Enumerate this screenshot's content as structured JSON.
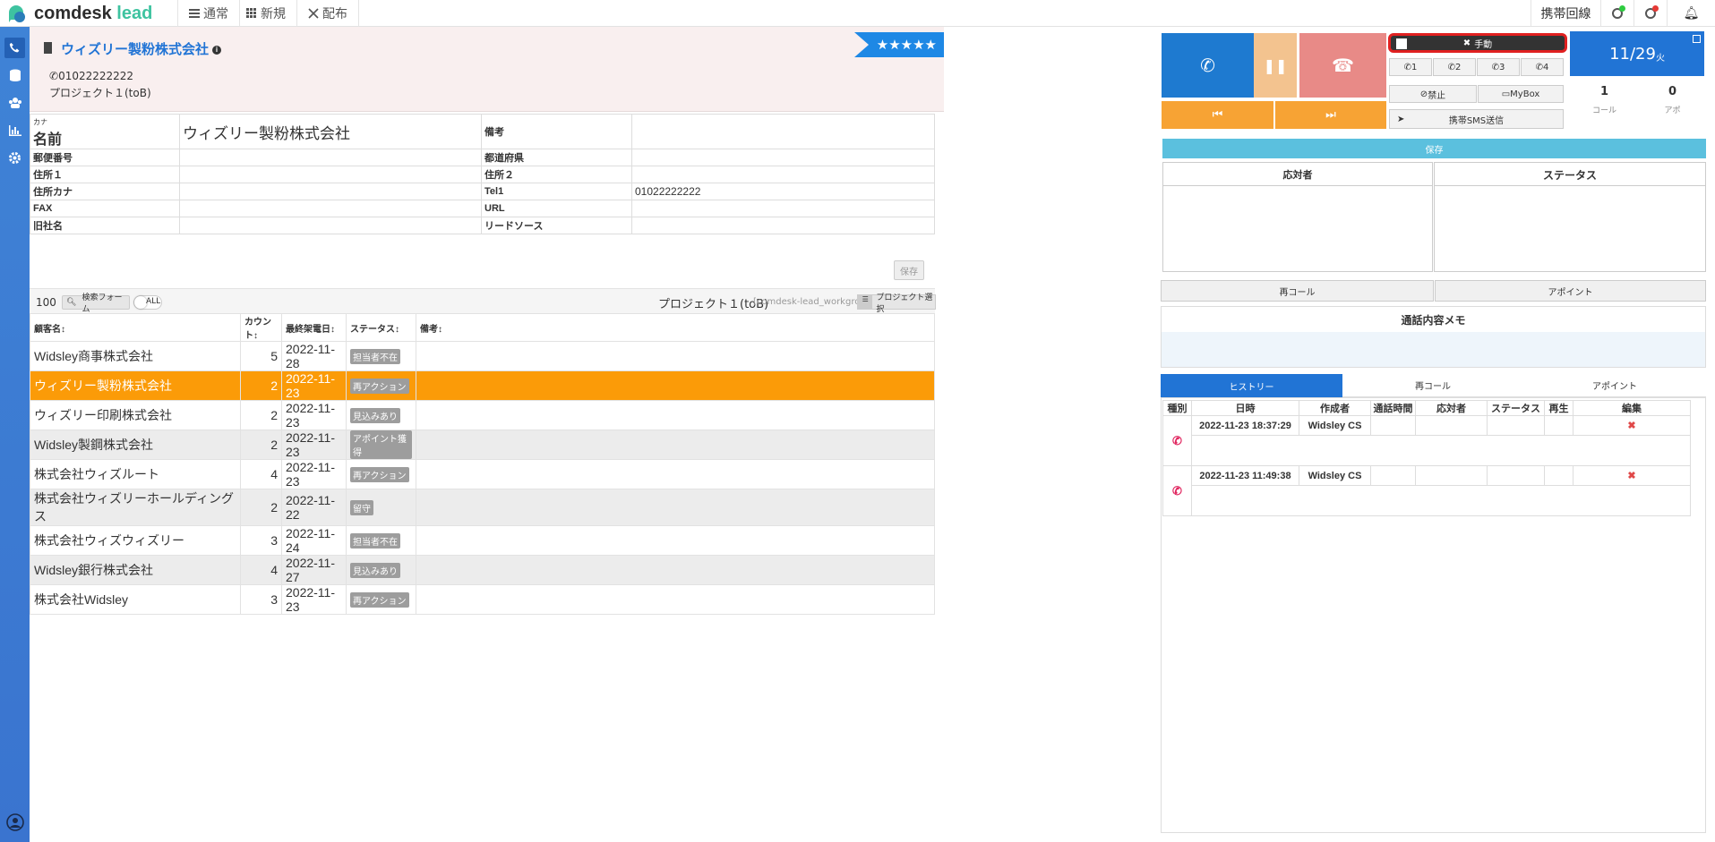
{
  "app": {
    "logo_main": "comdesk",
    "logo_accent": "lead"
  },
  "nav": {
    "normal": "通常",
    "new": "新規",
    "distribute": "配布"
  },
  "topbar_right": {
    "mobile_line": "携帯回線"
  },
  "company": {
    "name": "ウィズリー製粉株式会社",
    "phone": "01022222222",
    "project": "プロジェクト１(toB)",
    "rating": "★★★★★"
  },
  "detail": {
    "kana_label": "カナ",
    "name_label": "名前",
    "name_value": "ウィズリー製粉株式会社",
    "note_label": "備考",
    "zip_label": "郵便番号",
    "pref_label": "都道府県",
    "addr1_label": "住所１",
    "addr2_label": "住所２",
    "addr_kana_label": "住所カナ",
    "tel1_label": "Tel1",
    "tel1_value": "01022222222",
    "fax_label": "FAX",
    "url_label": "URL",
    "old_name_label": "旧社名",
    "lead_source_label": "リードソース",
    "save": "保存"
  },
  "list_toolbar": {
    "count": "100",
    "search_form": "検索フォーム",
    "all": "ALL",
    "project_title": "プロジェクト１(toB)",
    "workgroup": "[comdesk-lead_workgroup]",
    "project_select": "プロジェクト選択"
  },
  "list": {
    "headers": [
      "顧客名",
      "カウント",
      "最終架電日",
      "ステータス",
      "備考"
    ],
    "rows": [
      {
        "name": "Widsley商事株式会社",
        "count": "5",
        "date": "2022-11-28",
        "status": "担当者不在"
      },
      {
        "name": "ウィズリー製粉株式会社",
        "count": "2",
        "date": "2022-11-23",
        "status": "再アクション"
      },
      {
        "name": "ウィズリー印刷株式会社",
        "count": "2",
        "date": "2022-11-23",
        "status": "見込みあり"
      },
      {
        "name": "Widsley製鋼株式会社",
        "count": "2",
        "date": "2022-11-23",
        "status": "アポイント獲得"
      },
      {
        "name": "株式会社ウィズルート",
        "count": "4",
        "date": "2022-11-23",
        "status": "再アクション"
      },
      {
        "name": "株式会社ウィズリーホールディングス",
        "count": "2",
        "date": "2022-11-22",
        "status": "留守"
      },
      {
        "name": "株式会社ウィズウィズリー",
        "count": "3",
        "date": "2022-11-24",
        "status": "担当者不在"
      },
      {
        "name": "Widsley銀行株式会社",
        "count": "4",
        "date": "2022-11-27",
        "status": "見込みあり"
      },
      {
        "name": "株式会社Widsley",
        "count": "3",
        "date": "2022-11-23",
        "status": "再アクション"
      }
    ]
  },
  "phone": {
    "manual": "手動",
    "lines": [
      "1",
      "2",
      "3",
      "4"
    ],
    "ban": "禁止",
    "mybox": "MyBox",
    "sms": "携帯SMS送信",
    "date": "11/29",
    "weekday": "火",
    "calls": "0",
    "calls_raw": "1",
    "calls_label": "コール",
    "appo": "0",
    "appo_label": "アポ"
  },
  "right": {
    "save": "保存",
    "respondent": "応対者",
    "status": "ステータス",
    "recall": "再コール",
    "appointment": "アポイント",
    "memo": "通話内容メモ",
    "tabs": [
      "ヒストリー",
      "再コール",
      "アポイント"
    ],
    "history_headers": [
      "種別",
      "日時",
      "作成者",
      "通話時間",
      "応対者",
      "ステータス",
      "再生",
      "編集"
    ],
    "history": [
      {
        "datetime": "2022-11-23 18:37:29",
        "author": "Widsley CS"
      },
      {
        "datetime": "2022-11-23 11:49:38",
        "author": "Widsley CS"
      }
    ]
  },
  "colors": {
    "accent": "#2174d5",
    "selected": "#fb9b08",
    "call": "#1e7ad0",
    "hangup": "#e88a87",
    "pause": "#f3c38f",
    "nav": "#f7a334"
  }
}
